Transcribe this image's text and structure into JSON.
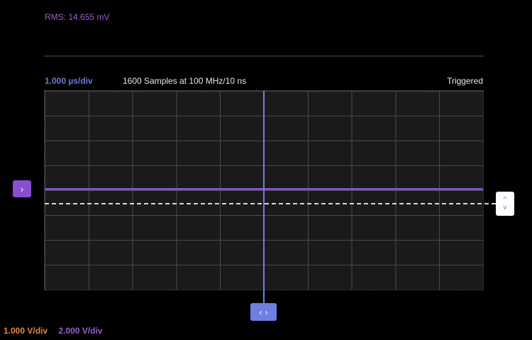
{
  "measurement": {
    "rms_label": "RMS: 14.655 mV",
    "color": "#9b5fd6"
  },
  "header": {
    "timebase": "1.000 µs/div",
    "samples": "1600 Samples at 100 MHz/10 ns",
    "trigger_status": "Triggered"
  },
  "handles": {
    "channel_marker_icon": "chevron-right-icon",
    "channel_marker_glyph": "›",
    "trigger_up_glyph": "^",
    "trigger_down_glyph": "v",
    "time_left_glyph": "‹",
    "time_right_glyph": "›"
  },
  "footer": {
    "ch1_scale": "1.000 V/div",
    "ch2_scale": "2.000 V/div"
  },
  "colors": {
    "timebase": "#6d7bd9",
    "trace": "#8a4fd0",
    "ch1": "#e08a3c",
    "ch2": "#9b5fd6",
    "trigger_level": "#d8d8d8",
    "cursor": "#6f7fe0"
  }
}
